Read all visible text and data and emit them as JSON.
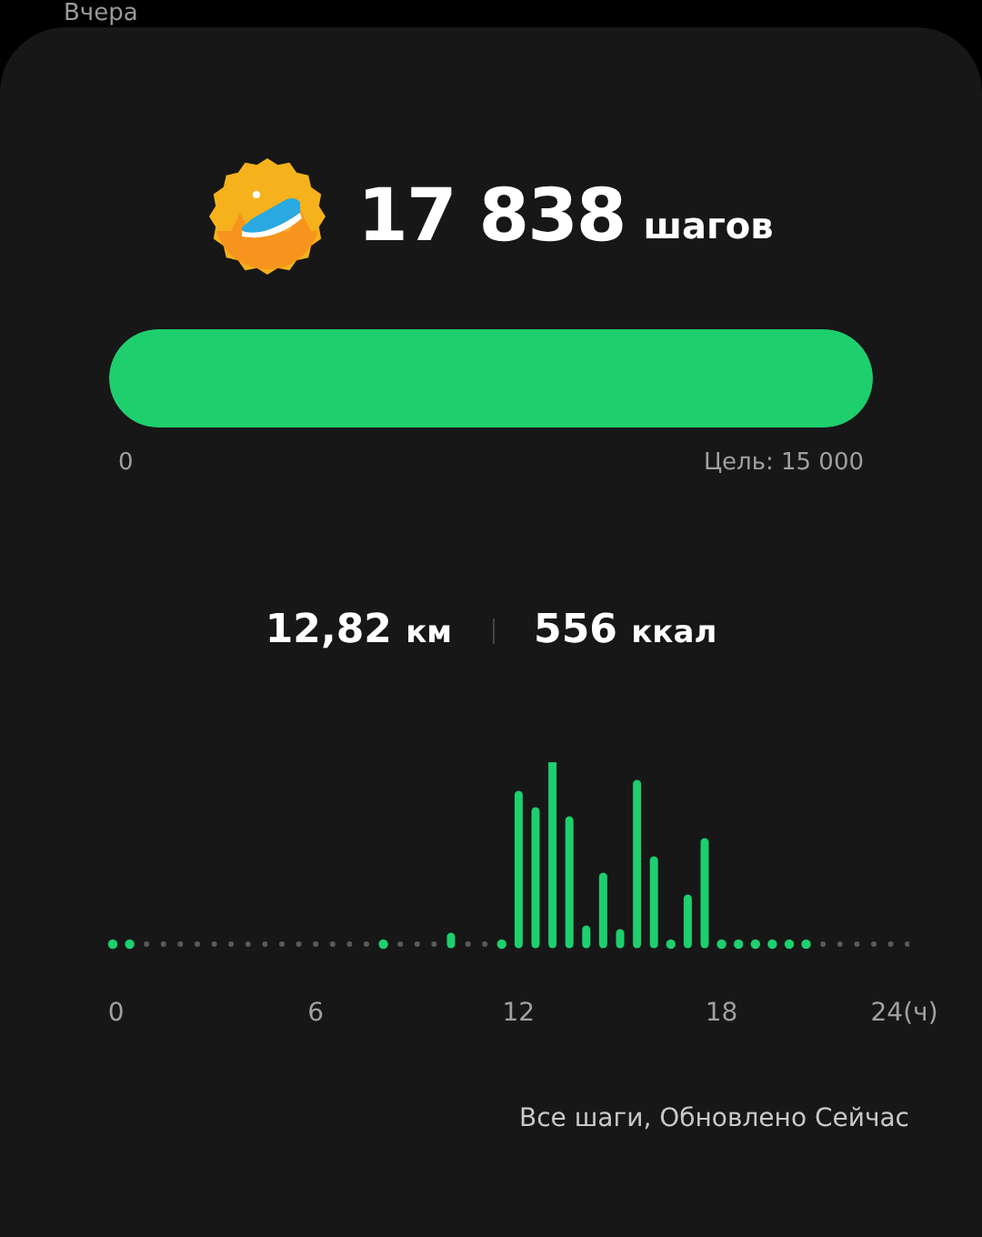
{
  "header": {
    "date": "Вчера"
  },
  "steps": {
    "count": "17 838",
    "unit": "шагов"
  },
  "progress": {
    "level": 1,
    "start_label": "0",
    "goal_label": "Цель: 15 000"
  },
  "stats": [
    {
      "value": "12,82",
      "unit": "км"
    },
    {
      "value": "556",
      "unit": "ккал"
    }
  ],
  "hourly_chart": {
    "x_labels": [
      "0",
      "6",
      "12",
      "18",
      "24(ч)"
    ]
  },
  "footer": {
    "link": "Все шаги, Обновлено Сейчас"
  }
}
